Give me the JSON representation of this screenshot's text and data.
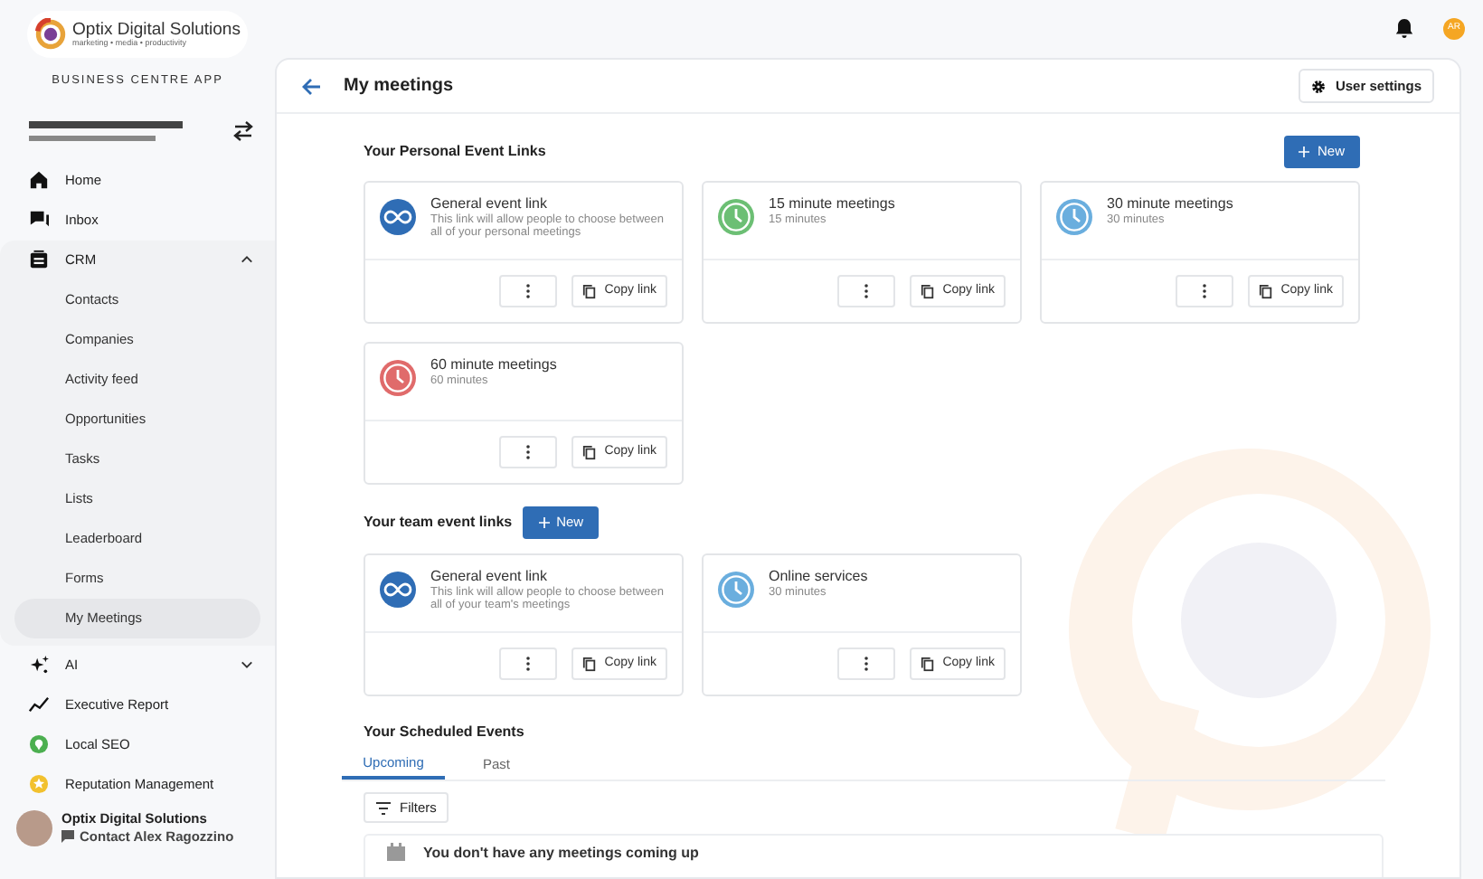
{
  "header": {
    "logo": {
      "name": "Optix Digital Solutions",
      "tagline": "marketing • media • productivity"
    },
    "app_label": "BUSINESS CENTRE APP",
    "avatar": {
      "initials": "AR"
    }
  },
  "sidebar": {
    "items": [
      {
        "label": "Home",
        "kind": "link",
        "selected": false
      },
      {
        "label": "Inbox",
        "kind": "link",
        "selected": false
      },
      {
        "label": "CRM",
        "kind": "group",
        "expanded": true,
        "selected": false,
        "children": [
          {
            "label": "Contacts",
            "selected": false
          },
          {
            "label": "Companies",
            "selected": false
          },
          {
            "label": "Activity feed",
            "selected": false
          },
          {
            "label": "Opportunities",
            "selected": false
          },
          {
            "label": "Tasks",
            "selected": false
          },
          {
            "label": "Lists",
            "selected": false
          },
          {
            "label": "Leaderboard",
            "selected": false
          },
          {
            "label": "Forms",
            "selected": false
          },
          {
            "label": "My Meetings",
            "selected": true
          }
        ]
      },
      {
        "label": "AI",
        "kind": "group",
        "expanded": false,
        "selected": false
      },
      {
        "label": "Executive Report",
        "kind": "link",
        "selected": false
      },
      {
        "label": "Local SEO",
        "kind": "link",
        "selected": false
      },
      {
        "label": "Reputation Management",
        "kind": "link",
        "selected": false
      }
    ],
    "footer": {
      "name": "Optix Digital Solutions",
      "contact": "Contact Alex Ragozzino"
    }
  },
  "page": {
    "title": "My meetings",
    "settings_button": "User settings",
    "sections": [
      {
        "title": "Your Personal Event Links",
        "new_button": "New",
        "cards": [
          {
            "kind": "general",
            "title": "General event link",
            "subtitle": "This link will allow people to choose between all of your personal meetings",
            "color": "#2f6db5",
            "copy": "Copy link"
          },
          {
            "kind": "clock",
            "title": "15 minute meetings",
            "subtitle": "15 minutes",
            "color": "#6cbf74",
            "copy": "Copy link"
          },
          {
            "kind": "clock",
            "title": "30 minute meetings",
            "subtitle": "30 minutes",
            "color": "#6aaede",
            "copy": "Copy link"
          },
          {
            "kind": "clock",
            "title": "60 minute meetings",
            "subtitle": "60 minutes",
            "color": "#e06b6b",
            "copy": "Copy link"
          }
        ]
      },
      {
        "title": "Your team event links",
        "new_button": "New",
        "cards": [
          {
            "kind": "general",
            "title": "General event link",
            "subtitle": "This link will allow people to choose between all of your team's meetings",
            "color": "#2f6db5",
            "copy": "Copy link"
          },
          {
            "kind": "clock",
            "title": "Online services",
            "subtitle": "30 minutes",
            "color": "#6aaede",
            "copy": "Copy link"
          }
        ]
      }
    ],
    "scheduled": {
      "title": "Your Scheduled Events",
      "tabs": [
        {
          "label": "Upcoming",
          "selected": true
        },
        {
          "label": "Past",
          "selected": false
        }
      ],
      "filters_button": "Filters",
      "empty_message": "You don't have any meetings coming up"
    }
  }
}
